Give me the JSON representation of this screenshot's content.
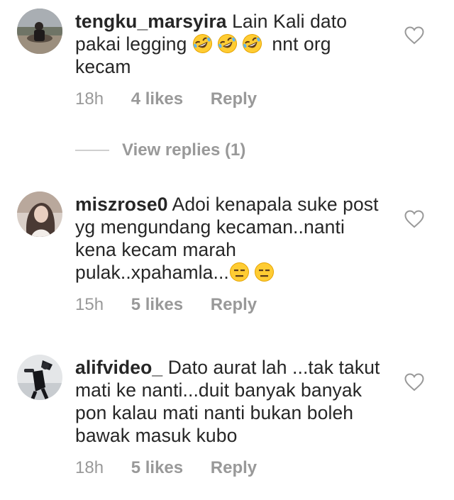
{
  "comments": [
    {
      "username": "tengku_marsyira",
      "text_before": "Lain Kali dato pakai legging",
      "emojis": [
        "rofl-emoji",
        "rofl-emoji",
        "rofl-emoji"
      ],
      "text_after": "nnt org kecam",
      "time": "18h",
      "likes": "4 likes",
      "reply": "Reply"
    },
    {
      "username": "miszrose0",
      "text_before": "Adoi kenapala suke post yg mengundang kecaman..nanti kena kecam marah pulak..xpahamla...",
      "emojis": [
        "expressionless-emoji",
        "expressionless-emoji"
      ],
      "text_after": "",
      "time": "15h",
      "likes": "5 likes",
      "reply": "Reply"
    },
    {
      "username": "alifvideo_",
      "text_before": "Dato aurat lah ...tak takut mati ke nanti...duit banyak banyak pon kalau mati nanti bukan boleh bawak masuk kubo",
      "emojis": [],
      "text_after": "",
      "time": "18h",
      "likes": "5 likes",
      "reply": "Reply"
    }
  ],
  "view_replies": "View replies (1)",
  "colors": {
    "text": "#262626",
    "muted": "#999999",
    "divider": "#cfcfcf"
  }
}
